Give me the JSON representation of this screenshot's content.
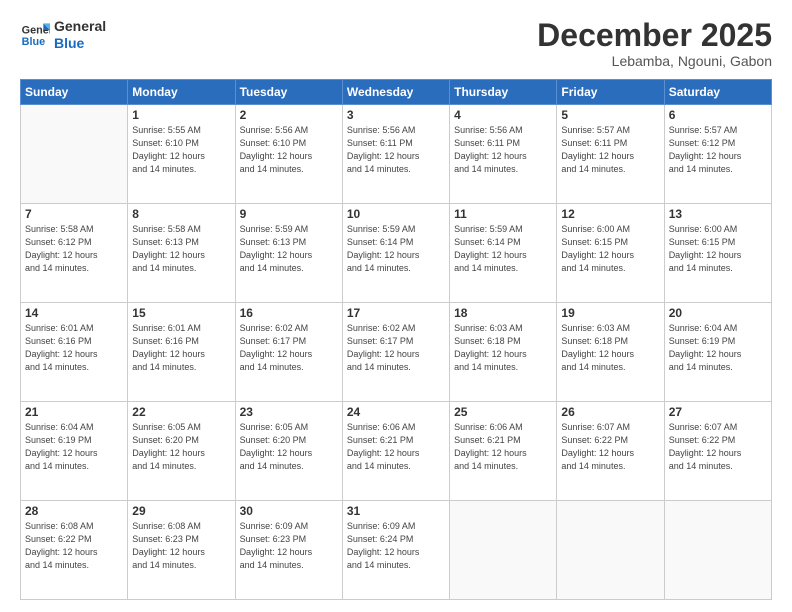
{
  "logo": {
    "line1": "General",
    "line2": "Blue"
  },
  "header": {
    "month": "December 2025",
    "location": "Lebamba, Ngouni, Gabon"
  },
  "weekdays": [
    "Sunday",
    "Monday",
    "Tuesday",
    "Wednesday",
    "Thursday",
    "Friday",
    "Saturday"
  ],
  "weeks": [
    [
      {
        "day": "",
        "info": ""
      },
      {
        "day": "1",
        "info": "Sunrise: 5:55 AM\nSunset: 6:10 PM\nDaylight: 12 hours\nand 14 minutes."
      },
      {
        "day": "2",
        "info": "Sunrise: 5:56 AM\nSunset: 6:10 PM\nDaylight: 12 hours\nand 14 minutes."
      },
      {
        "day": "3",
        "info": "Sunrise: 5:56 AM\nSunset: 6:11 PM\nDaylight: 12 hours\nand 14 minutes."
      },
      {
        "day": "4",
        "info": "Sunrise: 5:56 AM\nSunset: 6:11 PM\nDaylight: 12 hours\nand 14 minutes."
      },
      {
        "day": "5",
        "info": "Sunrise: 5:57 AM\nSunset: 6:11 PM\nDaylight: 12 hours\nand 14 minutes."
      },
      {
        "day": "6",
        "info": "Sunrise: 5:57 AM\nSunset: 6:12 PM\nDaylight: 12 hours\nand 14 minutes."
      }
    ],
    [
      {
        "day": "7",
        "info": "Sunrise: 5:58 AM\nSunset: 6:12 PM\nDaylight: 12 hours\nand 14 minutes."
      },
      {
        "day": "8",
        "info": "Sunrise: 5:58 AM\nSunset: 6:13 PM\nDaylight: 12 hours\nand 14 minutes."
      },
      {
        "day": "9",
        "info": "Sunrise: 5:59 AM\nSunset: 6:13 PM\nDaylight: 12 hours\nand 14 minutes."
      },
      {
        "day": "10",
        "info": "Sunrise: 5:59 AM\nSunset: 6:14 PM\nDaylight: 12 hours\nand 14 minutes."
      },
      {
        "day": "11",
        "info": "Sunrise: 5:59 AM\nSunset: 6:14 PM\nDaylight: 12 hours\nand 14 minutes."
      },
      {
        "day": "12",
        "info": "Sunrise: 6:00 AM\nSunset: 6:15 PM\nDaylight: 12 hours\nand 14 minutes."
      },
      {
        "day": "13",
        "info": "Sunrise: 6:00 AM\nSunset: 6:15 PM\nDaylight: 12 hours\nand 14 minutes."
      }
    ],
    [
      {
        "day": "14",
        "info": "Sunrise: 6:01 AM\nSunset: 6:16 PM\nDaylight: 12 hours\nand 14 minutes."
      },
      {
        "day": "15",
        "info": "Sunrise: 6:01 AM\nSunset: 6:16 PM\nDaylight: 12 hours\nand 14 minutes."
      },
      {
        "day": "16",
        "info": "Sunrise: 6:02 AM\nSunset: 6:17 PM\nDaylight: 12 hours\nand 14 minutes."
      },
      {
        "day": "17",
        "info": "Sunrise: 6:02 AM\nSunset: 6:17 PM\nDaylight: 12 hours\nand 14 minutes."
      },
      {
        "day": "18",
        "info": "Sunrise: 6:03 AM\nSunset: 6:18 PM\nDaylight: 12 hours\nand 14 minutes."
      },
      {
        "day": "19",
        "info": "Sunrise: 6:03 AM\nSunset: 6:18 PM\nDaylight: 12 hours\nand 14 minutes."
      },
      {
        "day": "20",
        "info": "Sunrise: 6:04 AM\nSunset: 6:19 PM\nDaylight: 12 hours\nand 14 minutes."
      }
    ],
    [
      {
        "day": "21",
        "info": "Sunrise: 6:04 AM\nSunset: 6:19 PM\nDaylight: 12 hours\nand 14 minutes."
      },
      {
        "day": "22",
        "info": "Sunrise: 6:05 AM\nSunset: 6:20 PM\nDaylight: 12 hours\nand 14 minutes."
      },
      {
        "day": "23",
        "info": "Sunrise: 6:05 AM\nSunset: 6:20 PM\nDaylight: 12 hours\nand 14 minutes."
      },
      {
        "day": "24",
        "info": "Sunrise: 6:06 AM\nSunset: 6:21 PM\nDaylight: 12 hours\nand 14 minutes."
      },
      {
        "day": "25",
        "info": "Sunrise: 6:06 AM\nSunset: 6:21 PM\nDaylight: 12 hours\nand 14 minutes."
      },
      {
        "day": "26",
        "info": "Sunrise: 6:07 AM\nSunset: 6:22 PM\nDaylight: 12 hours\nand 14 minutes."
      },
      {
        "day": "27",
        "info": "Sunrise: 6:07 AM\nSunset: 6:22 PM\nDaylight: 12 hours\nand 14 minutes."
      }
    ],
    [
      {
        "day": "28",
        "info": "Sunrise: 6:08 AM\nSunset: 6:22 PM\nDaylight: 12 hours\nand 14 minutes."
      },
      {
        "day": "29",
        "info": "Sunrise: 6:08 AM\nSunset: 6:23 PM\nDaylight: 12 hours\nand 14 minutes."
      },
      {
        "day": "30",
        "info": "Sunrise: 6:09 AM\nSunset: 6:23 PM\nDaylight: 12 hours\nand 14 minutes."
      },
      {
        "day": "31",
        "info": "Sunrise: 6:09 AM\nSunset: 6:24 PM\nDaylight: 12 hours\nand 14 minutes."
      },
      {
        "day": "",
        "info": ""
      },
      {
        "day": "",
        "info": ""
      },
      {
        "day": "",
        "info": ""
      }
    ]
  ]
}
